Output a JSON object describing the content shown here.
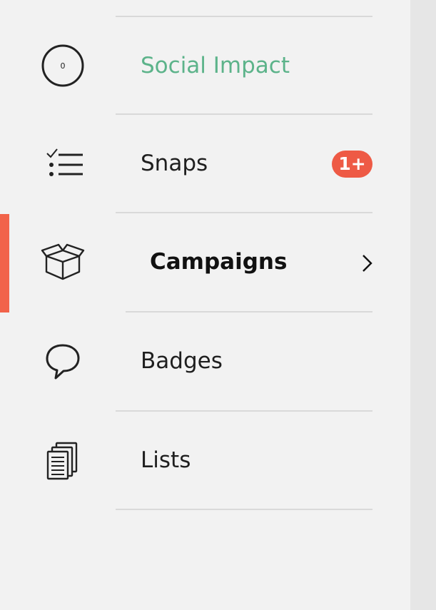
{
  "menu": {
    "items": [
      {
        "label": "Social Impact",
        "icon": "circle-counter-icon",
        "counter": "0",
        "color": "#5cb38a"
      },
      {
        "label": "Snaps",
        "icon": "checklist-icon",
        "badge": "1+",
        "badge_color": "#ee5a45"
      },
      {
        "label": "Campaigns",
        "icon": "open-box-icon",
        "active": true,
        "indicator_color": "#f2634a"
      },
      {
        "label": "Badges",
        "icon": "speech-bubble-icon"
      },
      {
        "label": "Lists",
        "icon": "documents-icon"
      }
    ]
  }
}
